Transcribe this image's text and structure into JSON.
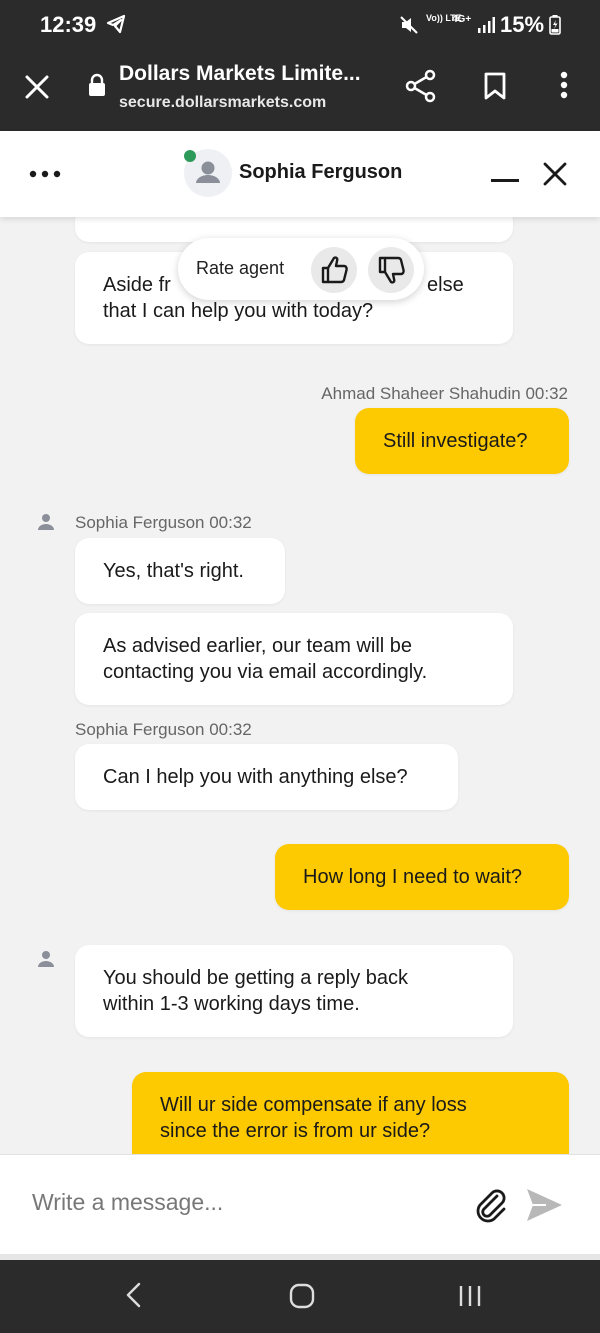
{
  "status_bar": {
    "time": "12:39",
    "volte": "Vo)) LTE",
    "network": "4G+",
    "battery": "15%"
  },
  "browser": {
    "title": "Dollars Markets Limite...",
    "url": "secure.dollarsmarkets.com"
  },
  "chat_header": {
    "agent_name": "Sophia Ferguson",
    "online_color": "#2e9a5a"
  },
  "rate_popup": {
    "label": "Rate agent"
  },
  "messages": {
    "m1_line1": "Aside fr",
    "m1_line1_tail": "else",
    "m1_line2": "that I can help you with today?",
    "user_sender1": "Ahmad Shaheer Shahudin 00:32",
    "u1": "Still investigate?",
    "agent_sender1": "Sophia Ferguson 00:32",
    "a1": "Yes, that's right.",
    "a2_line1": "As advised earlier, our team will be",
    "a2_line2": "contacting you via email accordingly.",
    "agent_sender2": "Sophia Ferguson 00:32",
    "a3": "Can I help you with anything else?",
    "u2": "How long I need to wait?",
    "a4_line1": "You should be getting a reply back",
    "a4_line2": "within 1-3 working days time.",
    "u3_line1": "Will ur side compensate if any loss",
    "u3_line2": "since the error is from ur side?"
  },
  "input": {
    "placeholder": "Write a message..."
  },
  "colors": {
    "user_bubble": "#fdc900",
    "header_bg": "#2b2b2b",
    "background": "#f2f2f2"
  }
}
